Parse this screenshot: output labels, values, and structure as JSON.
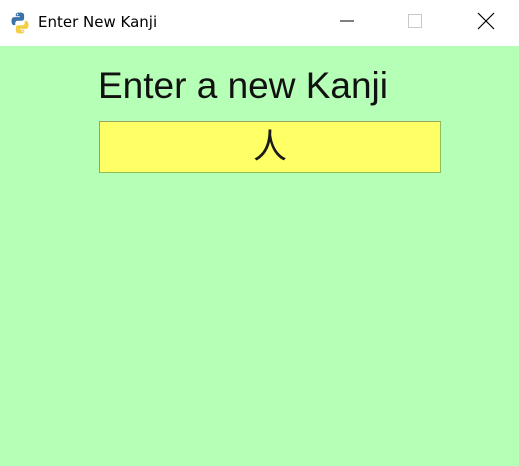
{
  "window": {
    "title": "Enter New Kanji",
    "icon": "python-icon",
    "controls": [
      "minimize-icon",
      "maximize-icon",
      "close-icon"
    ]
  },
  "form": {
    "prompt": "Enter a new Kanji",
    "entry_value": "人"
  },
  "colors": {
    "background": "#b6ffb6",
    "entry_background": "#ffff66",
    "titlebar": "#ffffff"
  }
}
